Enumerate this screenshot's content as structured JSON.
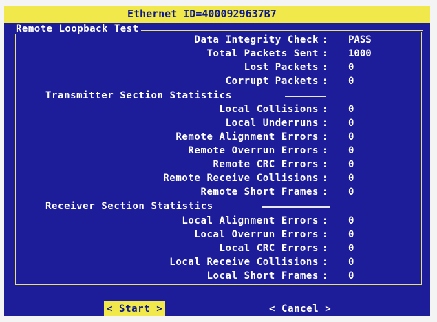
{
  "title": "Ethernet ID=4000929637B7",
  "panel_title": "Remote Loopback Test",
  "summary": [
    {
      "label": "Data Integrity Check",
      "value": "PASS"
    },
    {
      "label": "Total Packets Sent",
      "value": "1000"
    },
    {
      "label": "Lost Packets",
      "value": "0"
    },
    {
      "label": "Corrupt Packets",
      "value": "0"
    }
  ],
  "transmitter": {
    "heading": "Transmitter Section Statistics",
    "rows": [
      {
        "label": "Local Collisions",
        "value": "0"
      },
      {
        "label": "Local Underruns",
        "value": "0"
      },
      {
        "label": "Remote Alignment Errors",
        "value": "0"
      },
      {
        "label": "Remote Overrun Errors",
        "value": "0"
      },
      {
        "label": "Remote CRC Errors",
        "value": "0"
      },
      {
        "label": "Remote Receive Collisions",
        "value": "0"
      },
      {
        "label": "Remote Short Frames",
        "value": "0"
      }
    ]
  },
  "receiver": {
    "heading": "Receiver Section Statistics",
    "rows": [
      {
        "label": "Local Alignment Errors",
        "value": "0"
      },
      {
        "label": "Local Overrun Errors",
        "value": "0"
      },
      {
        "label": "Local CRC Errors",
        "value": "0"
      },
      {
        "label": "Local Receive Collisions",
        "value": "0"
      },
      {
        "label": "Local Short Frames",
        "value": "0"
      }
    ]
  },
  "colon": ":",
  "buttons": {
    "start": "< Start >",
    "cancel": "< Cancel >"
  },
  "colors": {
    "background": "#1d1d9a",
    "title_bar": "#f1e84c",
    "text": "#ffffff",
    "highlight_text": "#0f1a8a"
  }
}
